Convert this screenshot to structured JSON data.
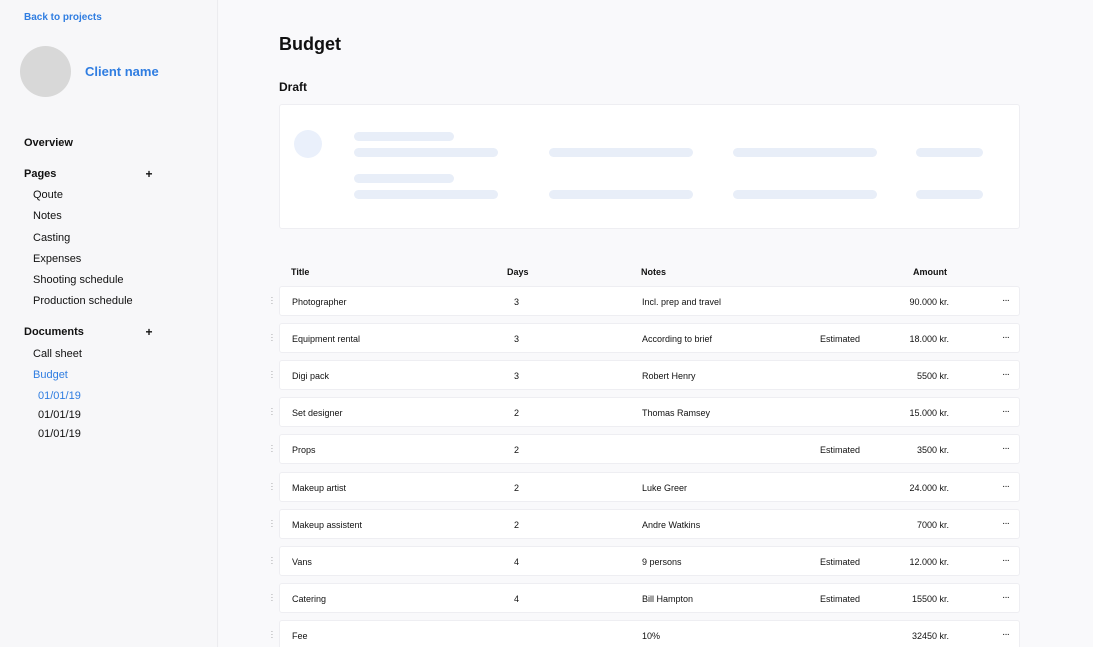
{
  "sidebar": {
    "back_label": "Back to projects",
    "client_name": "Client name",
    "overview": "Overview",
    "pages_label": "Pages",
    "pages_add": "+",
    "pages": [
      "Qoute",
      "Notes",
      "Casting",
      "Expenses",
      "Shooting schedule",
      "Production schedule"
    ],
    "documents_label": "Documents",
    "documents_add": "+",
    "documents": [
      "Call sheet",
      "Budget"
    ],
    "budget_versions": [
      "01/01/19",
      "01/01/19",
      "01/01/19"
    ]
  },
  "main": {
    "title": "Budget",
    "section": "Draft"
  },
  "table": {
    "headers": {
      "title": "Title",
      "days": "Days",
      "notes": "Notes",
      "amount": "Amount"
    },
    "rows": [
      {
        "title": "Photographer",
        "days": "3",
        "notes": "Incl. prep and travel",
        "status": "",
        "amount": "90.000 kr.",
        "menu": "···"
      },
      {
        "title": "Equipment rental",
        "days": "3",
        "notes": "According to brief",
        "status": "Estimated",
        "amount": "18.000 kr.",
        "menu": "···"
      },
      {
        "title": "Digi pack",
        "days": "3",
        "notes": "Robert Henry",
        "status": "",
        "amount": "5500 kr.",
        "menu": "···"
      },
      {
        "title": "Set designer",
        "days": "2",
        "notes": "Thomas Ramsey",
        "status": "",
        "amount": "15.000 kr.",
        "menu": "···"
      },
      {
        "title": "Props",
        "days": "2",
        "notes": "",
        "status": "Estimated",
        "amount": "3500 kr.",
        "menu": "···"
      },
      {
        "title": "Makeup artist",
        "days": "2",
        "notes": "Luke Greer",
        "status": "",
        "amount": "24.000 kr.",
        "menu": "···"
      },
      {
        "title": "Makeup assistent",
        "days": "2",
        "notes": "Andre Watkins",
        "status": "",
        "amount": "7000 kr.",
        "menu": "···"
      },
      {
        "title": "Vans",
        "days": "4",
        "notes": "9 persons",
        "status": "Estimated",
        "amount": "12.000 kr.",
        "menu": "···"
      },
      {
        "title": "Catering",
        "days": "4",
        "notes": "Bill Hampton",
        "status": "Estimated",
        "amount": "15500 kr.",
        "menu": "···"
      },
      {
        "title": "Fee",
        "days": "",
        "notes": "10%",
        "status": "",
        "amount": "32450 kr.",
        "menu": "···"
      }
    ]
  },
  "colors": {
    "accent": "#2f7de1",
    "skeleton": "#e8eef8"
  }
}
